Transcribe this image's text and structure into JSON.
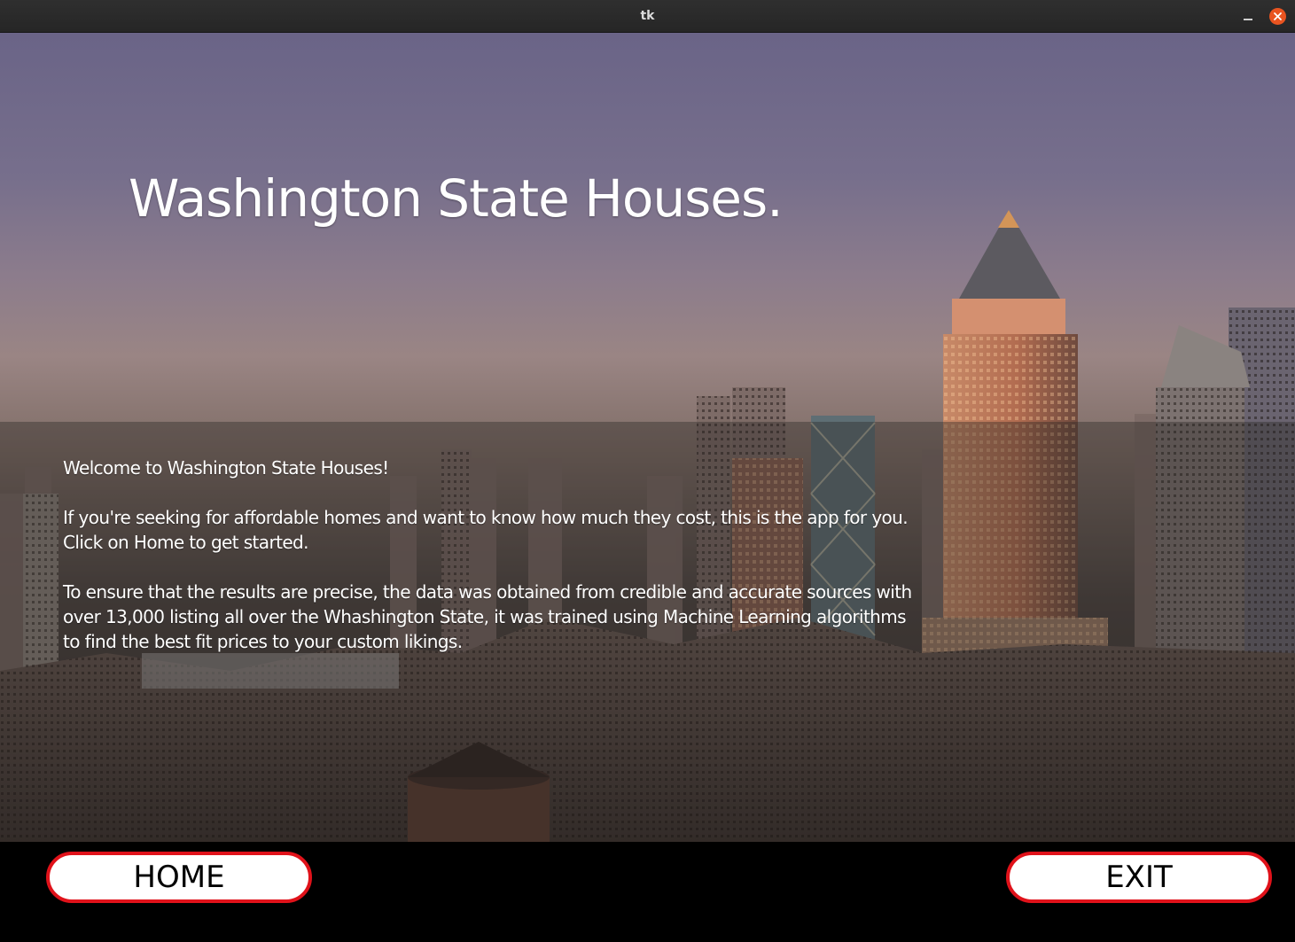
{
  "window": {
    "title": "tk"
  },
  "main": {
    "title": "Washington State Houses.",
    "paragraphs": [
      "Welcome to Washington State Houses!",
      "If you're seeking for affordable homes and want to know how much they cost, this is the app for you.",
      "Click on Home to get started.",
      "To ensure that the results are precise, the data was obtained from credible and accurate sources with",
      "over 13,000 listing all over the Whashington State, it was trained using Machine Learning algorithms",
      "to find the best fit prices to your custom likings."
    ]
  },
  "buttons": {
    "home_label": "HOME",
    "exit_label": "EXIT"
  },
  "colors": {
    "button_border": "#e0121a",
    "button_fill": "#ffffff",
    "bottom_bar": "#000000",
    "close_button": "#e95420"
  },
  "icons": {
    "minimize": "minimize-icon",
    "close": "close-icon"
  }
}
